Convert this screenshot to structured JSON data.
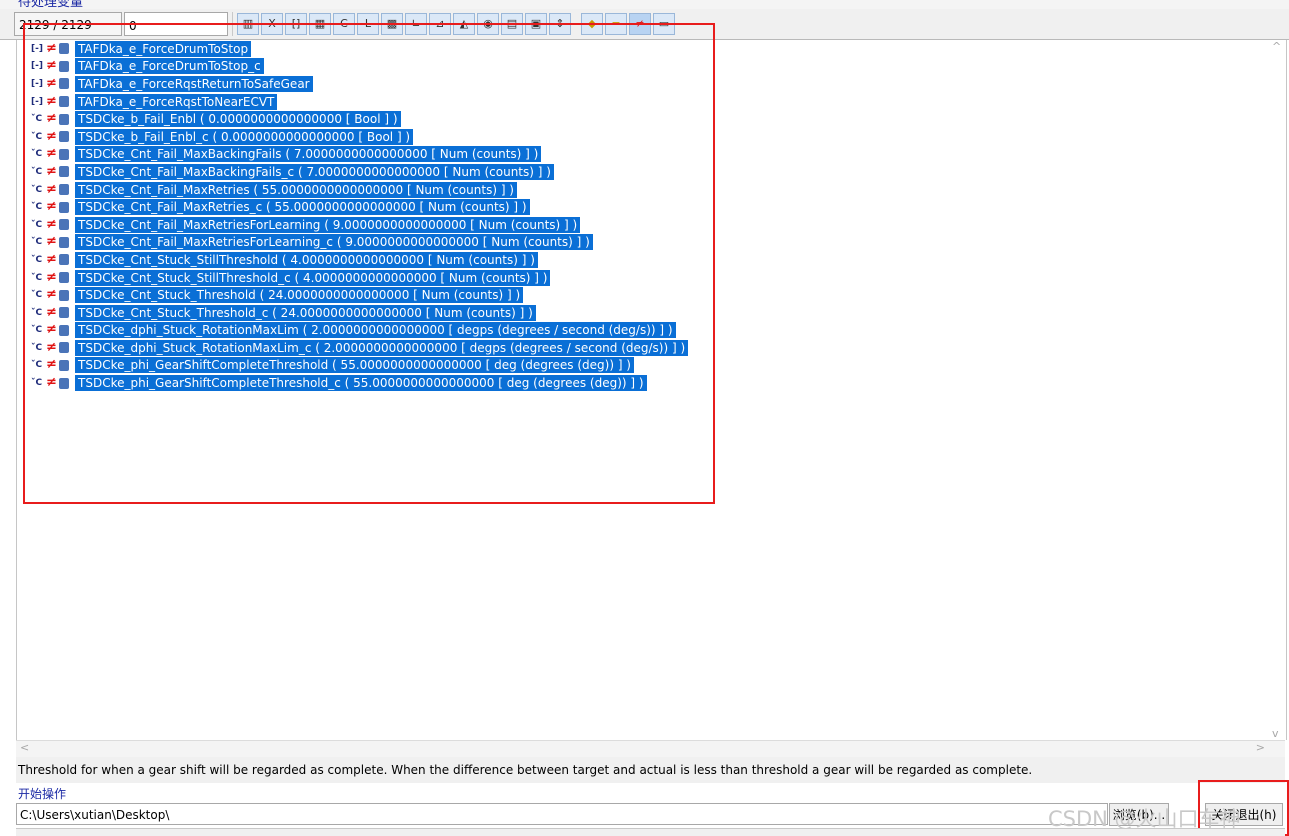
{
  "header": {
    "section_title": "待处理变量",
    "counter": "2129 / 2129",
    "value_field": "0"
  },
  "toolbar": {
    "buttons": [
      {
        "icon": "filter-bars-icon"
      },
      {
        "icon": "variable-x-icon"
      },
      {
        "icon": "bracket-icon"
      },
      {
        "icon": "array-icon"
      },
      {
        "icon": "curve-icon"
      },
      {
        "icon": "line-icon"
      },
      {
        "icon": "map-icon"
      },
      {
        "icon": "axis-icon"
      },
      {
        "icon": "chart-icon"
      },
      {
        "icon": "chart2-icon"
      },
      {
        "icon": "globe-icon"
      },
      {
        "icon": "matrix-icon"
      },
      {
        "icon": "save-icon"
      },
      {
        "icon": "split-icon"
      },
      {
        "icon": "tag-icon"
      },
      {
        "icon": "equal-icon"
      },
      {
        "icon": "not-equal-icon"
      },
      {
        "icon": "window-icon"
      }
    ]
  },
  "tree": {
    "items": [
      {
        "type": "bracket",
        "label": "TAFDka_e_ForceDrumToStop"
      },
      {
        "type": "bracket",
        "label": "TAFDka_e_ForceDrumToStop_c"
      },
      {
        "type": "bracket",
        "label": "TAFDka_e_ForceRqstReturnToSafeGear"
      },
      {
        "type": "bracket",
        "label": "TAFDka_e_ForceRqstToNearECVT"
      },
      {
        "type": "calib",
        "label": "TSDCke_b_Fail_Enbl ( 0.0000000000000000 [ Bool ]  )"
      },
      {
        "type": "calib",
        "label": "TSDCke_b_Fail_Enbl_c ( 0.0000000000000000 [ Bool ]  )"
      },
      {
        "type": "calib",
        "label": "TSDCke_Cnt_Fail_MaxBackingFails ( 7.0000000000000000 [ Num (counts) ]  )"
      },
      {
        "type": "calib",
        "label": "TSDCke_Cnt_Fail_MaxBackingFails_c ( 7.0000000000000000 [ Num (counts) ]  )"
      },
      {
        "type": "calib",
        "label": "TSDCke_Cnt_Fail_MaxRetries ( 55.0000000000000000 [ Num (counts) ]  )"
      },
      {
        "type": "calib",
        "label": "TSDCke_Cnt_Fail_MaxRetries_c ( 55.0000000000000000 [ Num (counts) ]  )"
      },
      {
        "type": "calib",
        "label": "TSDCke_Cnt_Fail_MaxRetriesForLearning ( 9.0000000000000000 [ Num (counts) ]  )"
      },
      {
        "type": "calib",
        "label": "TSDCke_Cnt_Fail_MaxRetriesForLearning_c ( 9.0000000000000000 [ Num (counts) ]  )"
      },
      {
        "type": "calib",
        "label": "TSDCke_Cnt_Stuck_StillThreshold ( 4.0000000000000000 [ Num (counts) ]  )"
      },
      {
        "type": "calib",
        "label": "TSDCke_Cnt_Stuck_StillThreshold_c ( 4.0000000000000000 [ Num (counts) ]  )"
      },
      {
        "type": "calib",
        "label": "TSDCke_Cnt_Stuck_Threshold ( 24.0000000000000000 [ Num (counts) ]  )"
      },
      {
        "type": "calib",
        "label": "TSDCke_Cnt_Stuck_Threshold_c ( 24.0000000000000000 [ Num (counts) ]  )"
      },
      {
        "type": "calib",
        "label": "TSDCke_dphi_Stuck_RotationMaxLim ( 2.0000000000000000 [ degps (degrees / second  (deg/s)) ]  )"
      },
      {
        "type": "calib",
        "label": "TSDCke_dphi_Stuck_RotationMaxLim_c ( 2.0000000000000000 [ degps (degrees / second  (deg/s)) ]  )"
      },
      {
        "type": "calib",
        "label": "TSDCke_phi_GearShiftCompleteThreshold ( 55.0000000000000000 [ deg (degrees (deg)) ]  )"
      },
      {
        "type": "calib",
        "label": "TSDCke_phi_GearShiftCompleteThreshold_c ( 55.0000000000000000 [ deg (degrees (deg)) ]  )"
      }
    ]
  },
  "description": "Threshold for when a gear shift will be regarded as complete. When the difference between target and actual is less than threshold a gear will be regarded as complete.",
  "footer": {
    "start_label": "开始操作",
    "path": "C:\\Users\\xutian\\Desktop\\",
    "browse_label": "浏览(b)...",
    "exit_label": "关闭退出(h)",
    "watermark": "CSDN @火山口车神"
  },
  "colors": {
    "selection": "#0a6fd6",
    "annotation_red": "#e81c1c",
    "link_blue": "#1c2aa5"
  }
}
